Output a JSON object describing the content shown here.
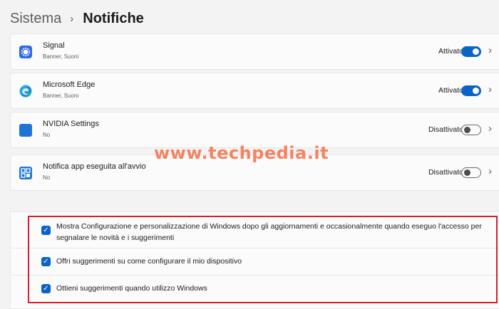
{
  "breadcrumb": {
    "parent": "Sistema",
    "separator": "›",
    "current": "Notifiche"
  },
  "apps": [
    {
      "name": "Signal",
      "subtitle": "Banner, Suoni",
      "state": "Attivato",
      "on": true,
      "icon": "signal-icon",
      "icon_color": "#2c6bed"
    },
    {
      "name": "Microsoft Edge",
      "subtitle": "Banner, Suoni",
      "state": "Attivato",
      "on": true,
      "icon": "edge-icon",
      "icon_color": "#1a8cd8"
    },
    {
      "name": "NVIDIA Settings",
      "subtitle": "No",
      "state": "Disattivato",
      "on": false,
      "icon": "nvidia-settings-icon",
      "icon_color": "#1f73d6"
    },
    {
      "name": "Notifica app eseguita all'avvio",
      "subtitle": "No",
      "state": "Disattivato",
      "on": false,
      "icon": "startup-apps-icon",
      "icon_color": "#1f73d6"
    }
  ],
  "watermark": "www.techpedia.it",
  "options": [
    {
      "text": "Mostra Configurazione e personalizzazione di Windows dopo gli aggiornamenti e occasionalmente quando eseguo l'accesso per segnalare le novità e i suggerimenti",
      "checked": true
    },
    {
      "text": "Offri suggerimenti su come configurare il mio dispositivo",
      "checked": true
    },
    {
      "text": "Ottieni suggerimenti quando utilizzo Windows",
      "checked": true
    }
  ],
  "colors": {
    "accent": "#0a64c4",
    "highlight_border": "#d71f2b",
    "watermark": "#f35a2a"
  }
}
